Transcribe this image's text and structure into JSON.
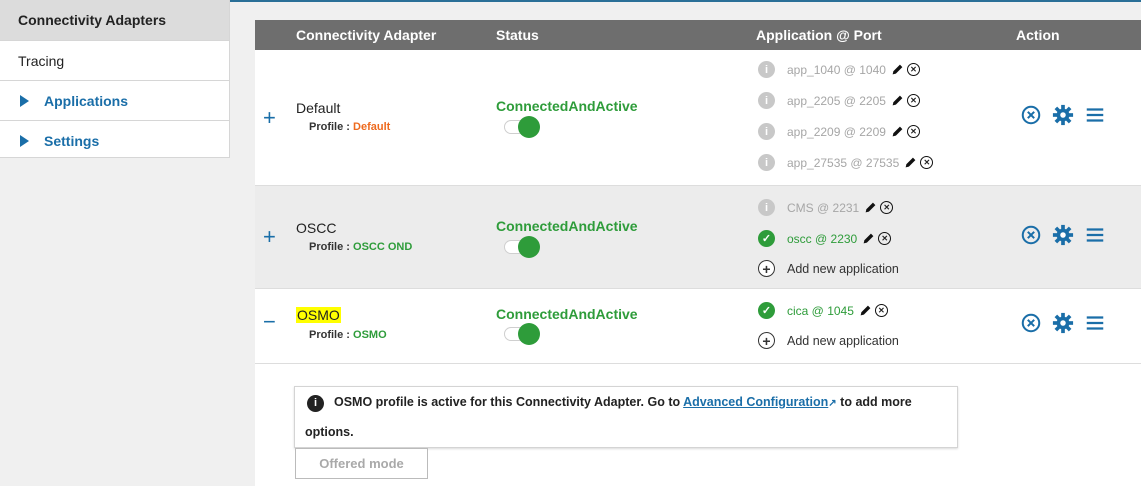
{
  "sidebar": {
    "items": [
      {
        "label": "Connectivity Adapters"
      },
      {
        "label": "Tracing"
      },
      {
        "label": "Applications"
      },
      {
        "label": "Settings"
      }
    ]
  },
  "table": {
    "headers": [
      "Connectivity Adapter",
      "Status",
      "Application @ Port",
      "Action"
    ],
    "profile_label": "Profile :",
    "rows": [
      {
        "expander": "+",
        "name": "Default",
        "profile": "Default",
        "status": "ConnectedAndActive",
        "apps": [
          "app_1040 @ 1040",
          "app_2205 @ 2205",
          "app_2209 @ 2209",
          "app_27535 @ 27535"
        ]
      },
      {
        "expander": "+",
        "name": "OSCC",
        "profile": "OSCC OND",
        "status": "ConnectedAndActive",
        "apps": [
          "CMS @ 2231",
          "oscc @ 2230"
        ],
        "add_label": "Add new application"
      },
      {
        "expander": "−",
        "name": "OSMO",
        "profile": "OSMO",
        "status": "ConnectedAndActive",
        "apps": [
          "cica @ 1045"
        ],
        "add_label": "Add new application"
      }
    ]
  },
  "notice": {
    "text_before": "OSMO profile is active for this Connectivity Adapter. Go to",
    "link": "Advanced Configuration",
    "text_after": "to add more",
    "text_line2": "options."
  },
  "offered_mode": "Offered mode",
  "colors": {
    "accent": "#1a6ea8",
    "ok": "#2e9c3a",
    "orange": "#ee6a1e"
  }
}
